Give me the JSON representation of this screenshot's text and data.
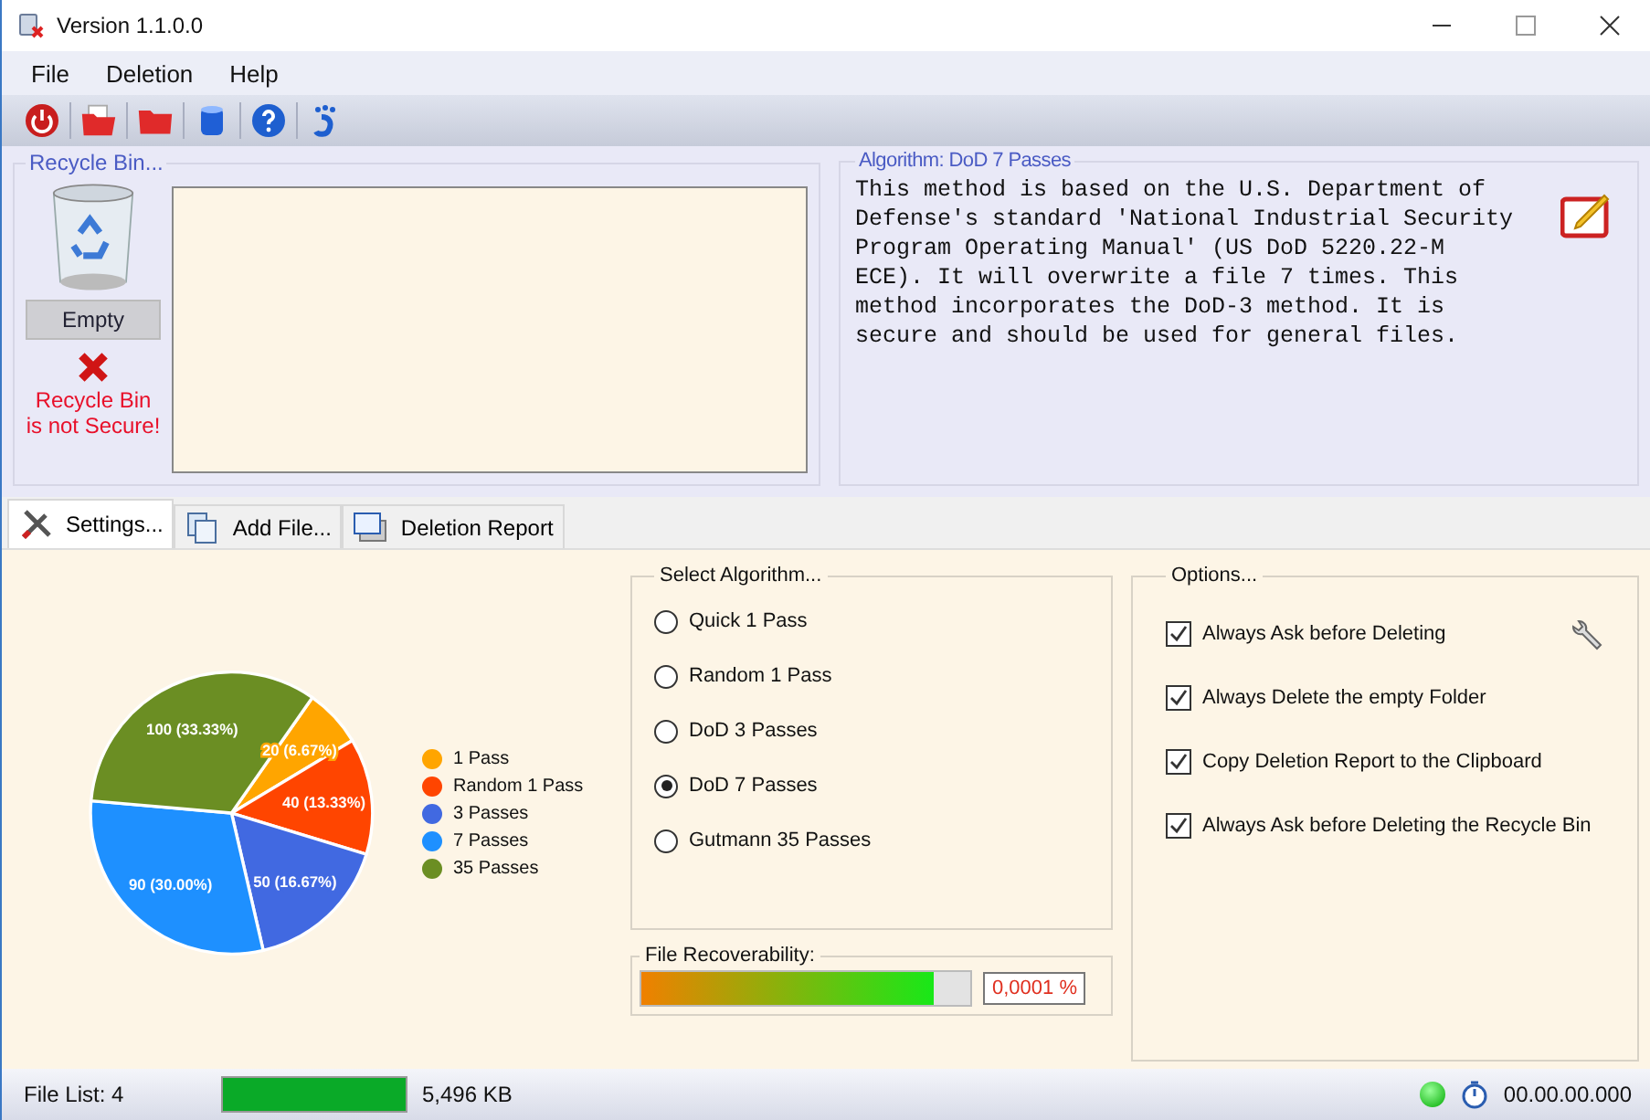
{
  "window": {
    "title": "Version 1.1.0.0"
  },
  "menu": [
    "File",
    "Deletion",
    "Help"
  ],
  "recycle_bin": {
    "title": "Recycle Bin...",
    "empty_button": "Empty",
    "warning": "Recycle Bin\nis not Secure!",
    "secure": false
  },
  "algorithm_info": {
    "title": "Algorithm: DoD 7 Passes",
    "description": "This method is based on the U.S. Department of Defense's standard 'National Industrial Security Program Operating Manual' (US DoD 5220.22-M ECE). It will overwrite a file 7 times. This method incorporates the DoD-3 method. It is secure and should be used for general files."
  },
  "tabs": [
    {
      "label": "Settings...",
      "selected": true,
      "kind": "settings"
    },
    {
      "label": "Add File...",
      "selected": false,
      "kind": "add"
    },
    {
      "label": "Deletion Report",
      "selected": false,
      "kind": "report"
    }
  ],
  "chart": {
    "chart_data": {
      "type": "pie",
      "legend": "right",
      "categories": [
        "1 Pass",
        "Random 1 Pass",
        "3 Passes",
        "7 Passes",
        "35 Passes"
      ],
      "values": [
        20,
        40,
        50,
        90,
        100
      ],
      "colors": [
        "#ffa500",
        "#ff4500",
        "#4169e1",
        "#1e90ff",
        "#6b8e23"
      ],
      "value_labels": [
        "20 (6.67%)",
        "40 (13.33%)",
        "50 (16.67%)",
        "90 (30.00%)",
        "100 (33.33%)"
      ]
    }
  },
  "select_algorithm": {
    "title": "Select Algorithm...",
    "options": [
      {
        "label": "Quick 1 Pass",
        "selected": false
      },
      {
        "label": "Random 1 Pass",
        "selected": false
      },
      {
        "label": "DoD 3 Passes",
        "selected": false
      },
      {
        "label": "DoD 7 Passes",
        "selected": true
      },
      {
        "label": "Gutmann 35 Passes",
        "selected": false
      }
    ]
  },
  "file_recoverability": {
    "title": "File Recoverability:",
    "level": 0.89,
    "reading": "0,0001 %"
  },
  "options": {
    "title": "Options...",
    "items": [
      {
        "label": "Always Ask before Deleting",
        "checked": true
      },
      {
        "label": "Always Delete the empty Folder",
        "checked": true
      },
      {
        "label": "Copy Deletion Report to the Clipboard",
        "checked": true
      },
      {
        "label": "Always Ask before Deleting the Recycle Bin",
        "checked": true
      }
    ]
  },
  "status_bar": {
    "file_list": "File List: 4",
    "level": 1,
    "size": "5,496 KB",
    "online": true,
    "time": "00.00.00.000"
  }
}
